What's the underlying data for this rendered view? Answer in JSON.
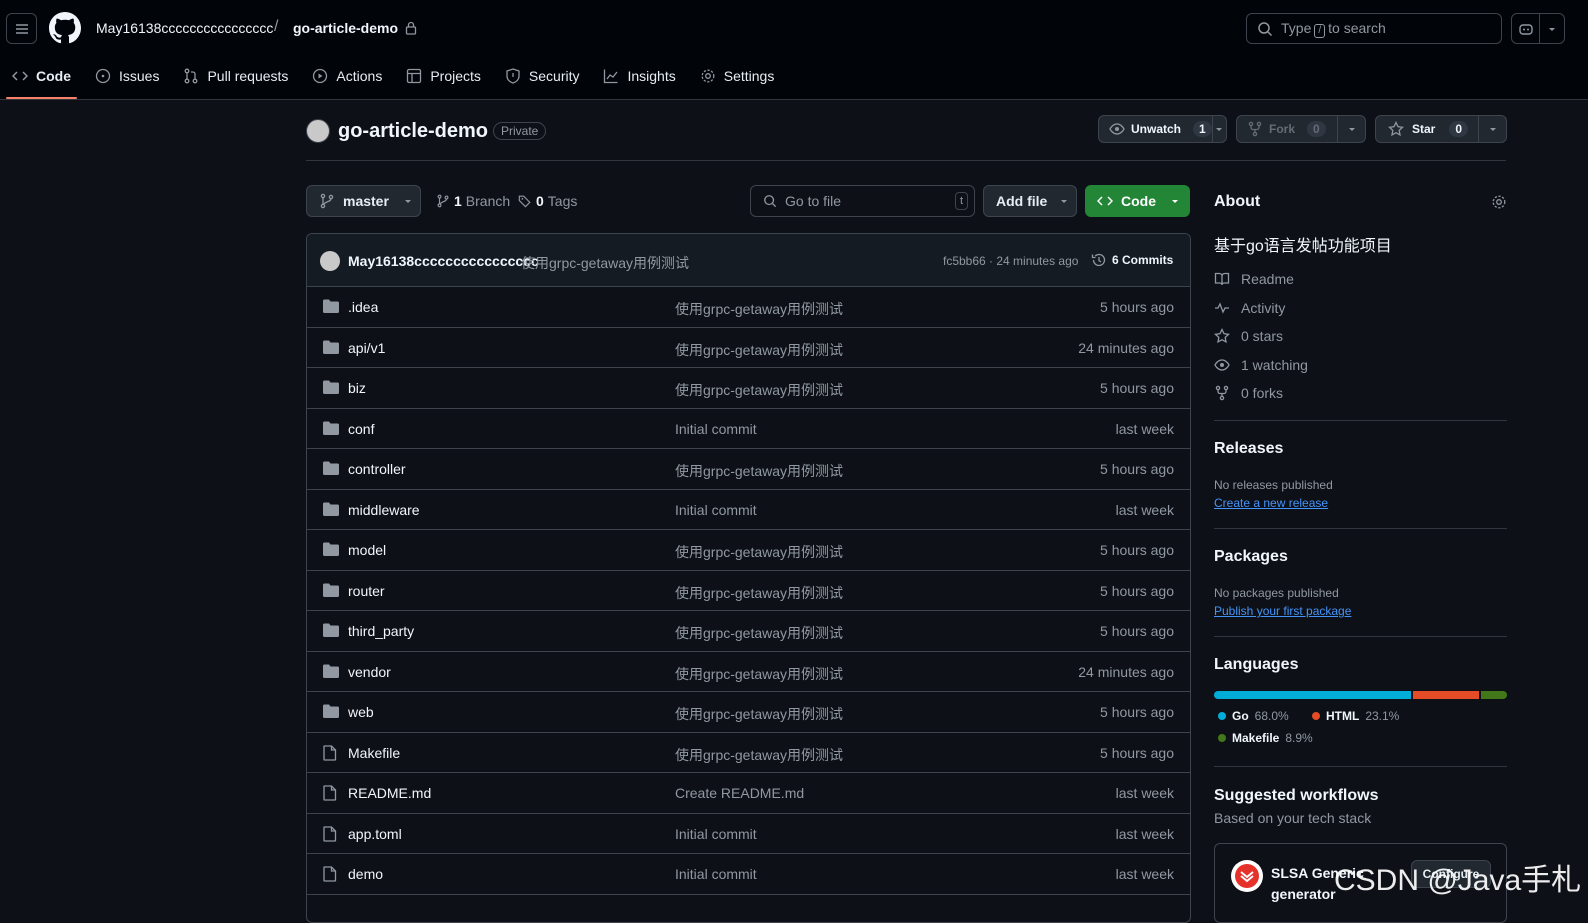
{
  "header": {
    "owner": "May16138cccccccccccccccc",
    "separator": "/",
    "repo": "go-article-demo",
    "search_prefix": "Type",
    "search_key": "/",
    "search_suffix": "to search"
  },
  "tabs": [
    {
      "label": "Code",
      "icon": "code-icon"
    },
    {
      "label": "Issues",
      "icon": "issue-icon"
    },
    {
      "label": "Pull requests",
      "icon": "pull-request-icon"
    },
    {
      "label": "Actions",
      "icon": "play-icon"
    },
    {
      "label": "Projects",
      "icon": "table-icon"
    },
    {
      "label": "Security",
      "icon": "shield-icon"
    },
    {
      "label": "Insights",
      "icon": "graph-icon"
    },
    {
      "label": "Settings",
      "icon": "gear-icon"
    }
  ],
  "repo": {
    "title": "go-article-demo",
    "visibility": "Private",
    "watch_label": "Unwatch",
    "watch_count": "1",
    "fork_label": "Fork",
    "fork_count": "0",
    "star_label": "Star",
    "star_count": "0"
  },
  "toolbar": {
    "branch": "master",
    "branch_count": "1",
    "branch_label": "Branch",
    "tag_count": "0",
    "tag_label": "Tags",
    "gofile_placeholder": "Go to file",
    "gofile_key": "t",
    "addfile_label": "Add file",
    "code_label": "Code"
  },
  "commit": {
    "author": "May16138cccccccccccccccc",
    "message": "使用grpc-getaway用例测试",
    "hash_time": "fc5bb66 · 24 minutes ago",
    "commits_label": "6 Commits"
  },
  "files": [
    {
      "name": ".idea",
      "type": "dir",
      "message": "使用grpc-getaway用例测试",
      "time": "5 hours ago"
    },
    {
      "name": "api/v1",
      "type": "dir",
      "message": "使用grpc-getaway用例测试",
      "time": "24 minutes ago"
    },
    {
      "name": "biz",
      "type": "dir",
      "message": "使用grpc-getaway用例测试",
      "time": "5 hours ago"
    },
    {
      "name": "conf",
      "type": "dir",
      "message": "Initial commit",
      "time": "last week"
    },
    {
      "name": "controller",
      "type": "dir",
      "message": "使用grpc-getaway用例测试",
      "time": "5 hours ago"
    },
    {
      "name": "middleware",
      "type": "dir",
      "message": "Initial commit",
      "time": "last week"
    },
    {
      "name": "model",
      "type": "dir",
      "message": "使用grpc-getaway用例测试",
      "time": "5 hours ago"
    },
    {
      "name": "router",
      "type": "dir",
      "message": "使用grpc-getaway用例测试",
      "time": "5 hours ago"
    },
    {
      "name": "third_party",
      "type": "dir",
      "message": "使用grpc-getaway用例测试",
      "time": "5 hours ago"
    },
    {
      "name": "vendor",
      "type": "dir",
      "message": "使用grpc-getaway用例测试",
      "time": "24 minutes ago"
    },
    {
      "name": "web",
      "type": "dir",
      "message": "使用grpc-getaway用例测试",
      "time": "5 hours ago"
    },
    {
      "name": "Makefile",
      "type": "file",
      "message": "使用grpc-getaway用例测试",
      "time": "5 hours ago"
    },
    {
      "name": "README.md",
      "type": "file",
      "message": "Create README.md",
      "time": "last week"
    },
    {
      "name": "app.toml",
      "type": "file",
      "message": "Initial commit",
      "time": "last week"
    },
    {
      "name": "demo",
      "type": "file",
      "message": "Initial commit",
      "time": "last week"
    }
  ],
  "about": {
    "title": "About",
    "description": "基于go语言发帖功能项目",
    "items": [
      {
        "label": "Readme",
        "icon": "book-icon"
      },
      {
        "label": "Activity",
        "icon": "pulse-icon"
      },
      {
        "label": "0 stars",
        "icon": "star-icon"
      },
      {
        "label": "1 watching",
        "icon": "eye-icon"
      },
      {
        "label": "0 forks",
        "icon": "fork-icon"
      }
    ]
  },
  "releases": {
    "title": "Releases",
    "empty": "No releases published",
    "link": "Create a new release"
  },
  "packages": {
    "title": "Packages",
    "empty": "No packages published",
    "link": "Publish your first package"
  },
  "languages": {
    "title": "Languages",
    "items": [
      {
        "name": "Go",
        "percent": "68.0%",
        "value": 68.0,
        "color": "#00add8"
      },
      {
        "name": "HTML",
        "percent": "23.1%",
        "value": 23.1,
        "color": "#e34c26"
      },
      {
        "name": "Makefile",
        "percent": "8.9%",
        "value": 8.9,
        "color": "#427819"
      }
    ]
  },
  "workflows": {
    "title": "Suggested workflows",
    "subtitle": "Based on your tech stack",
    "card_name_line1": "SLSA Generic",
    "card_name_line2": "generator",
    "card_button": "Configure"
  },
  "watermark": "CSDN @Java手札"
}
